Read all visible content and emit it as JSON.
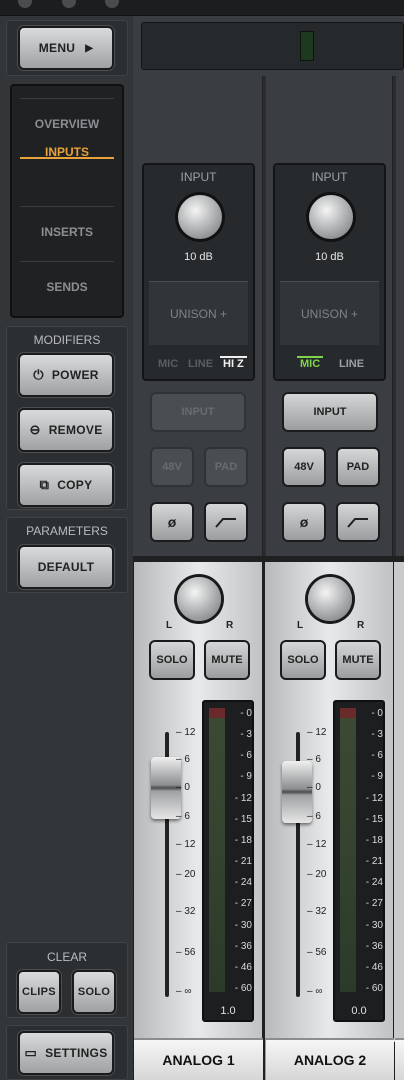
{
  "sidebar": {
    "menu_label": "MENU",
    "nav": [
      "OVERVIEW",
      "INPUTS",
      "INSERTS",
      "SENDS"
    ],
    "active_nav": "INPUTS",
    "modifiers_label": "MODIFIERS",
    "power_label": "POWER",
    "remove_label": "REMOVE",
    "copy_label": "COPY",
    "parameters_label": "PARAMETERS",
    "default_label": "DEFAULT",
    "clear_label": "CLEAR",
    "clips_label": "CLIPS",
    "solo_label": "SOLO",
    "settings_label": "SETTINGS"
  },
  "channels": [
    {
      "input_title": "INPUT",
      "gain": "10 dB",
      "unison": "UNISON +",
      "source": [
        "MIC",
        "LINE",
        "HI Z"
      ],
      "selected_source": "HI Z",
      "input_button": "INPUT",
      "phantom": "48V",
      "pad": "PAD",
      "phase": "ø",
      "hpf": "⌐",
      "pan_l": "L",
      "pan_r": "R",
      "solo": "SOLO",
      "mute": "MUTE",
      "meter_value": "1.0",
      "name": "ANALOG 1",
      "fader_db": 3
    },
    {
      "input_title": "INPUT",
      "gain": "10 dB",
      "unison": "UNISON +",
      "source": [
        "MIC",
        "LINE"
      ],
      "selected_source": "MIC",
      "input_button": "INPUT",
      "phantom": "48V",
      "pad": "PAD",
      "phase": "ø",
      "hpf": "⌐",
      "pan_l": "L",
      "pan_r": "R",
      "solo": "SOLO",
      "mute": "MUTE",
      "meter_value": "0.0",
      "name": "ANALOG 2",
      "fader_db": 0
    }
  ],
  "fader_scale": [
    "12",
    "6",
    "0",
    "6",
    "12",
    "20",
    "32",
    "56",
    "∞"
  ],
  "meter_scale": [
    "0",
    "3",
    "6",
    "9",
    "12",
    "15",
    "18",
    "21",
    "24",
    "27",
    "30",
    "36",
    "46",
    "60"
  ],
  "colors": {
    "accent": "#e9a23a",
    "mic_selected": "#7fd44a"
  }
}
